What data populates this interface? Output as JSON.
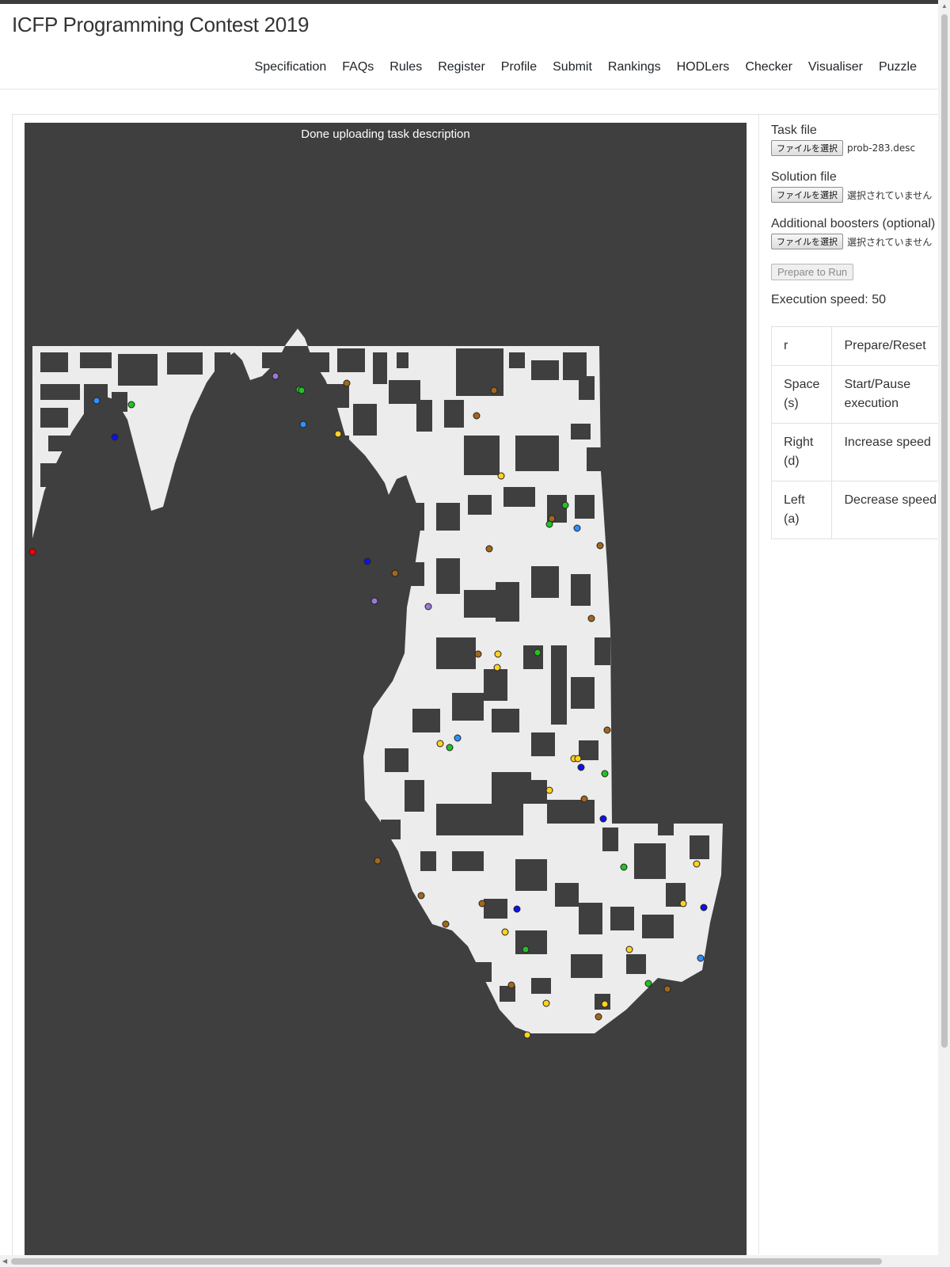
{
  "site": {
    "title": "ICFP Programming Contest 2019"
  },
  "nav": {
    "items": [
      {
        "id": "specification",
        "label": "Specification"
      },
      {
        "id": "faqs",
        "label": "FAQs"
      },
      {
        "id": "rules",
        "label": "Rules"
      },
      {
        "id": "register",
        "label": "Register"
      },
      {
        "id": "profile",
        "label": "Profile"
      },
      {
        "id": "submit",
        "label": "Submit"
      },
      {
        "id": "rankings",
        "label": "Rankings"
      },
      {
        "id": "hodlers",
        "label": "HODLers"
      },
      {
        "id": "checker",
        "label": "Checker"
      },
      {
        "id": "visualiser",
        "label": "Visualiser"
      },
      {
        "id": "puzzle",
        "label": "Puzzle"
      }
    ]
  },
  "visualiser": {
    "status_message": "Done uploading task description",
    "colors": {
      "background": "#3f3f3f",
      "free_cell": "#ececec",
      "obstacle": "#3f3f3f",
      "robot": "#ff0000",
      "booster_manipulator": "#ffd21f",
      "booster_fast_wheels": "#a0681c",
      "booster_drill": "#22c222",
      "booster_teleport": "#2f8fff",
      "booster_clone": "#1010ee",
      "booster_spawn": "#9a78d8"
    }
  },
  "task_file": {
    "label": "Task file",
    "button_label": "ファイルを選択",
    "selected": "prob-283.desc"
  },
  "solution_file": {
    "label": "Solution file",
    "button_label": "ファイルを選択",
    "selected": "選択されていません"
  },
  "boosters_file": {
    "label": "Additional boosters (optional)",
    "button_label": "ファイルを選択",
    "selected": "選択されていません"
  },
  "prepare_button": {
    "label": "Prepare to Run"
  },
  "execution_speed": {
    "text": "Execution speed: 50",
    "value": 50
  },
  "keys": [
    {
      "key": "r",
      "action": "Prepare/Reset"
    },
    {
      "key": "Space (s)",
      "action": "Start/Pause execution"
    },
    {
      "key": "Right (d)",
      "action": "Increase speed"
    },
    {
      "key": "Left (a)",
      "action": "Decrease speed"
    }
  ]
}
